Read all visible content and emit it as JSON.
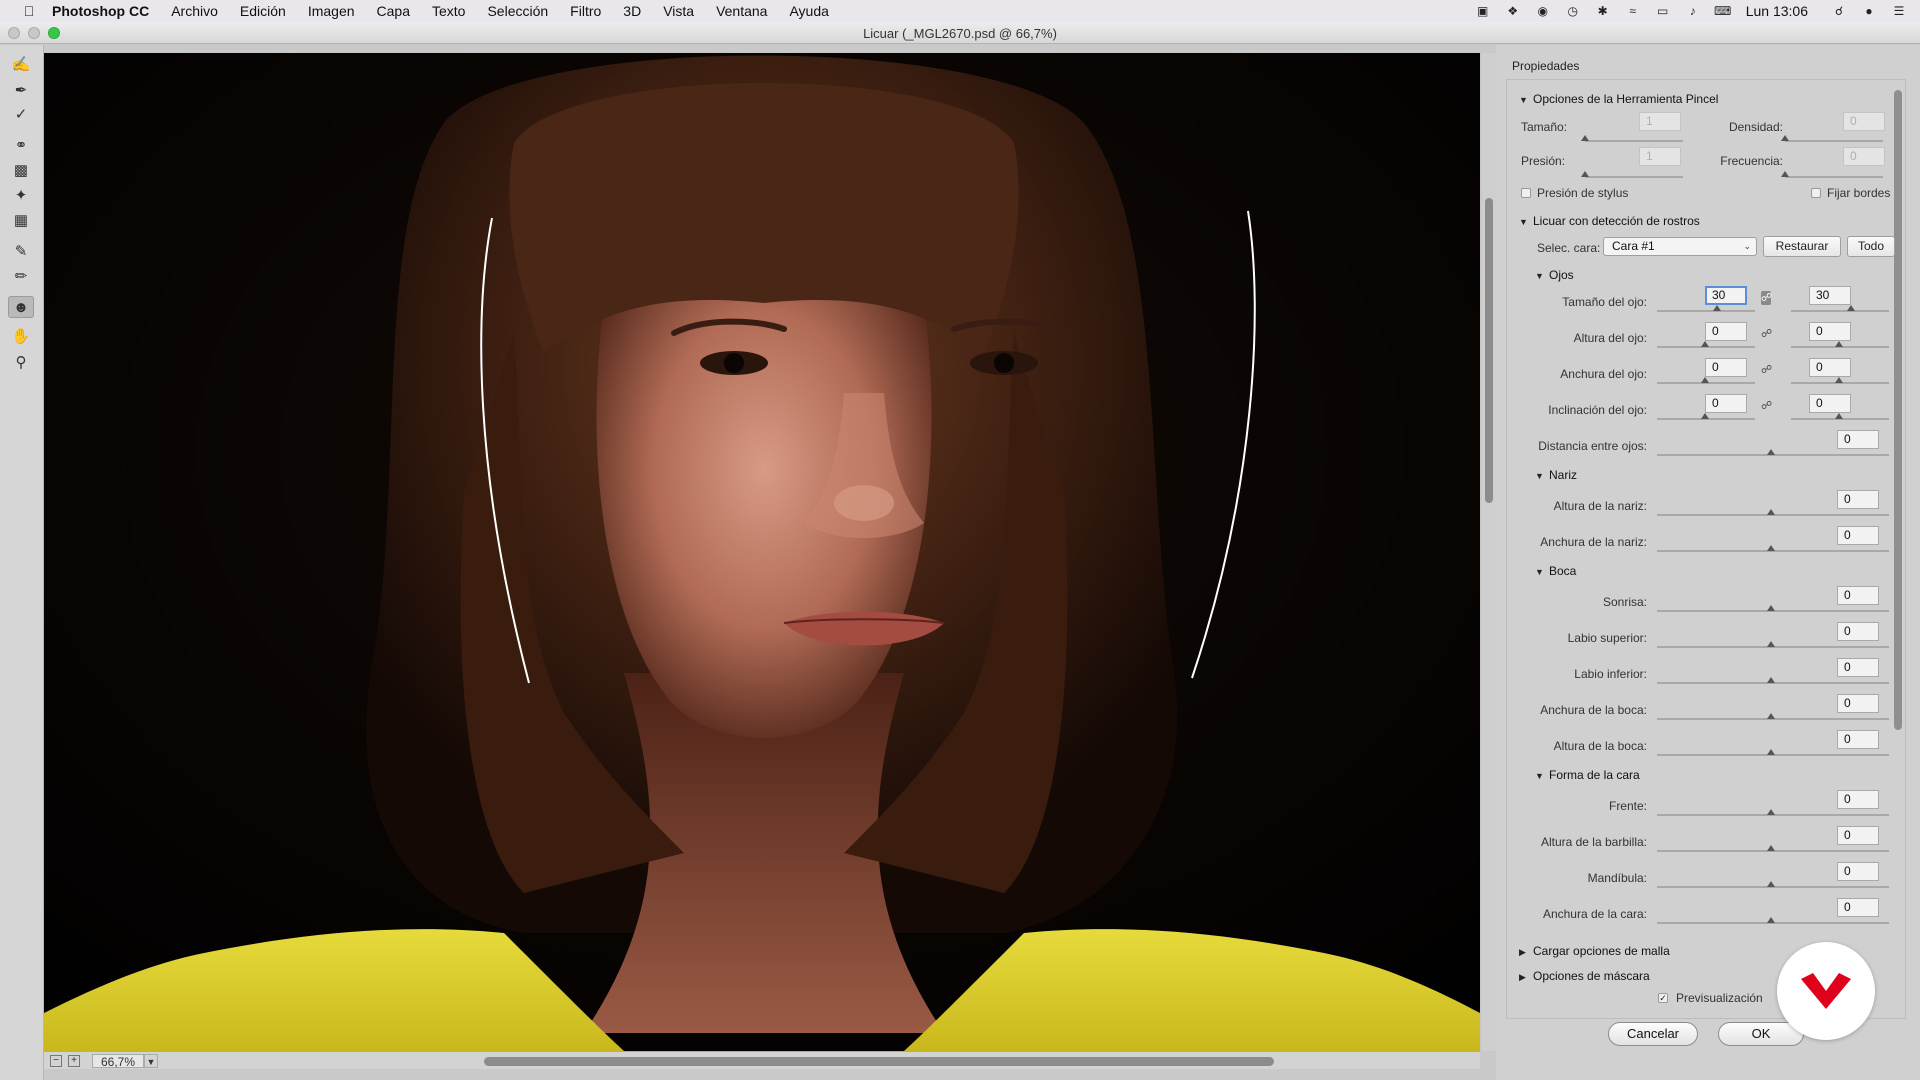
{
  "menubar": {
    "app_name": "Photoshop CC",
    "items": [
      "Archivo",
      "Edición",
      "Imagen",
      "Capa",
      "Texto",
      "Selección",
      "Filtro",
      "3D",
      "Vista",
      "Ventana",
      "Ayuda"
    ],
    "clock": "Lun 13:06"
  },
  "window": {
    "title": "Licuar (_MGL2670.psd @ 66,7%)"
  },
  "status": {
    "zoom": "66,7%"
  },
  "panel": {
    "title": "Propiedades",
    "brush": {
      "header": "Opciones de la Herramienta Pincel",
      "size_label": "Tamaño:",
      "size_value": "1",
      "density_label": "Densidad:",
      "density_value": "0",
      "pressure_label": "Presión:",
      "pressure_value": "1",
      "frequency_label": "Frecuencia:",
      "frequency_value": "0",
      "stylus_label": "Presión de stylus",
      "fix_edges_label": "Fijar bordes"
    },
    "face": {
      "header": "Licuar con detección de rostros",
      "select_label": "Selec. cara:",
      "select_value": "Cara #1",
      "restore_label": "Restaurar",
      "all_label": "Todo",
      "eyes_header": "Ojos",
      "eye_size_label": "Tamaño del ojo:",
      "eye_size_left": "30",
      "eye_size_right": "30",
      "eye_height_label": "Altura del ojo:",
      "eye_height_left": "0",
      "eye_height_right": "0",
      "eye_width_label": "Anchura del ojo:",
      "eye_width_left": "0",
      "eye_width_right": "0",
      "eye_tilt_label": "Inclinación del ojo:",
      "eye_tilt_left": "0",
      "eye_tilt_right": "0",
      "eye_distance_label": "Distancia entre ojos:",
      "eye_distance_value": "0",
      "nose_header": "Nariz",
      "nose_height_label": "Altura de la nariz:",
      "nose_height_value": "0",
      "nose_width_label": "Anchura de la nariz:",
      "nose_width_value": "0",
      "mouth_header": "Boca",
      "smile_label": "Sonrisa:",
      "smile_value": "0",
      "upper_lip_label": "Labio superior:",
      "upper_lip_value": "0",
      "lower_lip_label": "Labio inferior:",
      "lower_lip_value": "0",
      "mouth_width_label": "Anchura de la boca:",
      "mouth_width_value": "0",
      "mouth_height_label": "Altura de la boca:",
      "mouth_height_value": "0",
      "shape_header": "Forma de la cara",
      "forehead_label": "Frente:",
      "forehead_value": "0",
      "chin_label": "Altura de la barbilla:",
      "chin_value": "0",
      "jaw_label": "Mandíbula:",
      "jaw_value": "0",
      "face_width_label": "Anchura de la cara:",
      "face_width_value": "0"
    },
    "mesh_header": "Cargar opciones de malla",
    "mask_header": "Opciones de máscara",
    "preview_label": "Previsualización",
    "cancel_label": "Cancelar",
    "ok_label": "OK"
  },
  "colors": {
    "accent": "#5b8ed6",
    "logo_red": "#e0001b",
    "shirt": "#e3d52a"
  }
}
